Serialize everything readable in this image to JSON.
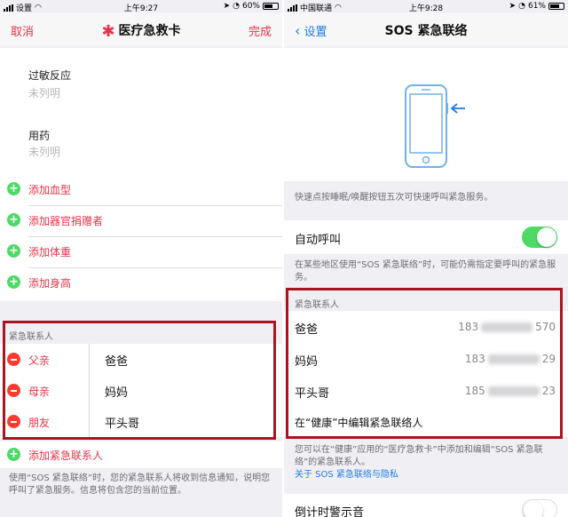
{
  "left": {
    "status": {
      "carrier": "设置",
      "time": "上午9:27",
      "battery": "60%"
    },
    "nav": {
      "cancel": "取消",
      "title": "医疗急救卡",
      "done": "完成"
    },
    "fields": [
      {
        "label": "过敏反应",
        "value": "未列明"
      },
      {
        "label": "用药",
        "value": "未列明"
      }
    ],
    "add_items": [
      "添加血型",
      "添加器官捐赠者",
      "添加体重",
      "添加身高"
    ],
    "emergency": {
      "title": "紧急联系人",
      "contacts": [
        {
          "relation": "父亲",
          "name": "爸爸"
        },
        {
          "relation": "母亲",
          "name": "妈妈"
        },
        {
          "relation": "朋友",
          "name": "平头哥"
        }
      ],
      "add_label": "添加紧急联系人"
    },
    "footer": "使用“SOS 紧急联络”时，您的紧急联系人将收到信息通知，说明您呼叫了紧急服务。信息将包含您的当前位置。"
  },
  "right": {
    "status": {
      "carrier": "中国联通",
      "time": "上午9:28",
      "battery": "61%"
    },
    "nav": {
      "back": "设置",
      "title": "SOS 紧急联络"
    },
    "desc": "快速点按睡眠/唤醒按钮五次可快速呼叫紧急服务。",
    "auto_call": {
      "label": "自动呼叫",
      "on": true
    },
    "auto_call_note": "在某些地区使用“SOS 紧急联络”时，可能仍需指定要呼叫的紧急服务。",
    "emergency": {
      "title": "紧急联系人",
      "contacts": [
        {
          "name": "爸爸",
          "prefix": "183",
          "suffix": "570"
        },
        {
          "name": "妈妈",
          "prefix": "183",
          "suffix": "29"
        },
        {
          "name": "平头哥",
          "prefix": "185",
          "suffix": "23"
        }
      ],
      "edit_link": "在“健康”中编辑紧急联络人"
    },
    "note": "您可以在“健康”应用的“医疗急救卡”中添加和编辑“SOS 紧急联络”的紧急联系人。",
    "privacy_link": "关于 SOS 紧急联络与隐私",
    "countdown_label": "倒计时警示音"
  },
  "colors": {
    "accent_red": "#e8334a",
    "green": "#4cd964",
    "link_blue": "#1f7ee8",
    "highlight_box": "#a9141e"
  }
}
